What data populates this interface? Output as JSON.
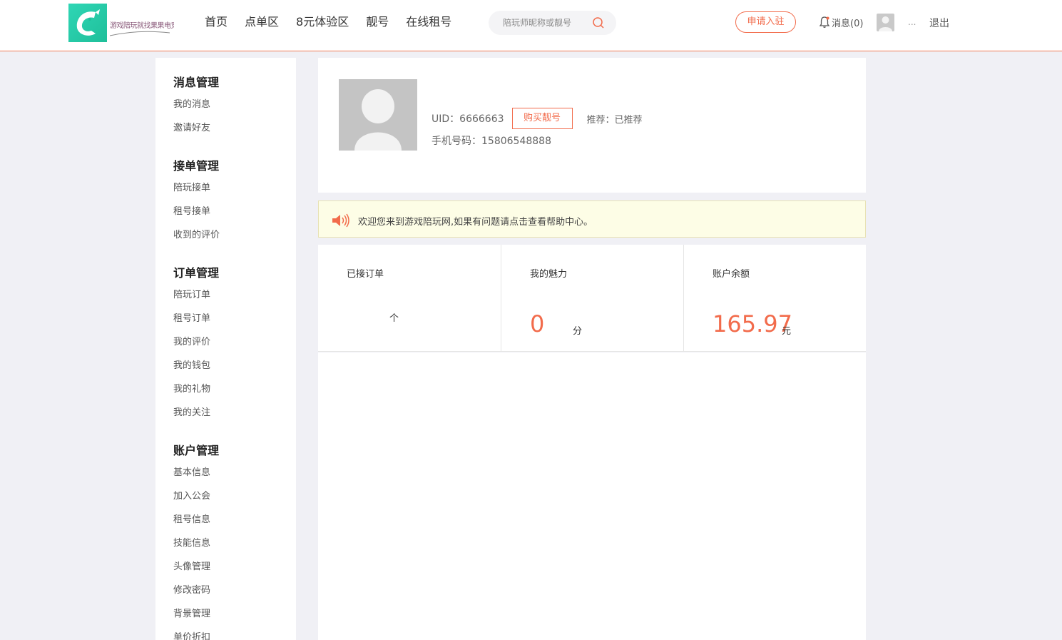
{
  "logo": {
    "text": "游戏陪玩就找果果电竞",
    "brand_color": "#2fd6b5"
  },
  "nav": {
    "items": [
      "首页",
      "点单区",
      "8元体验区",
      "靓号",
      "在线租号"
    ]
  },
  "search": {
    "placeholder": "陪玩师昵称或靓号",
    "icon": "search-icon"
  },
  "header_right": {
    "apply_label": "申请入驻",
    "messages_label": "消息(0)",
    "ellipsis": "...",
    "logout_label": "退出"
  },
  "sidebar": {
    "groups": [
      {
        "title": "消息管理",
        "items": [
          "我的消息",
          "邀请好友"
        ]
      },
      {
        "title": "接单管理",
        "items": [
          "陪玩接单",
          "租号接单",
          "收到的评价"
        ]
      },
      {
        "title": "订单管理",
        "items": [
          "陪玩订单",
          "租号订单",
          "我的评价",
          "我的钱包",
          "我的礼物",
          "我的关注"
        ]
      },
      {
        "title": "账户管理",
        "items": [
          "基本信息",
          "加入公会",
          "租号信息",
          "技能信息",
          "头像管理",
          "修改密码",
          "背景管理",
          "单价折扣"
        ]
      }
    ]
  },
  "profile": {
    "uid_label": "UID：6666663",
    "buy_label": "购买靓号",
    "recommend_label": "推荐：已推荐",
    "phone_label": "手机号码：15806548888"
  },
  "notice": {
    "text": "欢迎您来到游戏陪玩网,如果有问题请点击查看帮助中心。"
  },
  "stats": {
    "orders": {
      "label": "已接订单",
      "value": "",
      "unit": "个"
    },
    "charm": {
      "label": "我的魅力",
      "value": "0",
      "unit": "分"
    },
    "balance": {
      "label": "账户余额",
      "value": "165.97",
      "unit": "元"
    }
  },
  "colors": {
    "accent": "#f26b4b",
    "header_border": "#f07c55",
    "background": "#f0f0f5",
    "notice_bg": "#fdfde6"
  }
}
